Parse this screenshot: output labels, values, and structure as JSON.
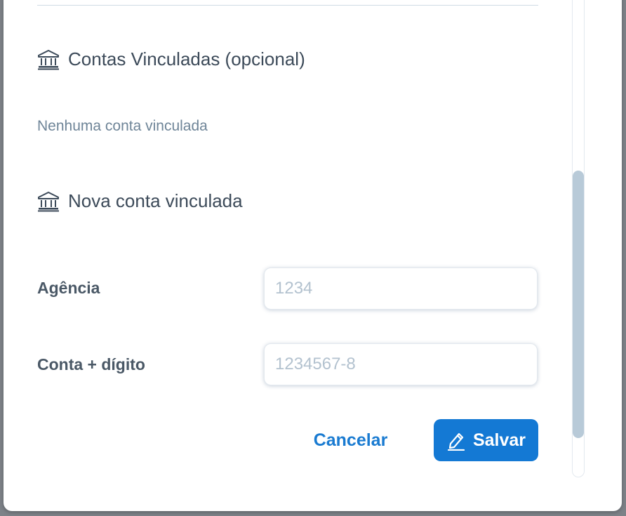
{
  "linked_accounts": {
    "heading": "Contas Vinculadas (opcional)",
    "heading_icon": "bank-icon",
    "empty_message": "Nenhuma conta vinculada"
  },
  "new_account": {
    "heading": "Nova conta vinculada",
    "heading_icon": "bank-icon",
    "fields": {
      "agencia": {
        "label": "Agência",
        "value": "",
        "placeholder": "1234"
      },
      "conta": {
        "label": "Conta + dígito",
        "value": "",
        "placeholder": "1234567-8"
      }
    }
  },
  "actions": {
    "cancel_label": "Cancelar",
    "save_label": "Salvar",
    "save_icon": "pencil-icon"
  },
  "colors": {
    "primary": "#1479d4",
    "link": "#1a7bd1",
    "text": "#3c4a59",
    "muted": "#6f8598",
    "scrollbar_thumb": "#b8cad8"
  }
}
